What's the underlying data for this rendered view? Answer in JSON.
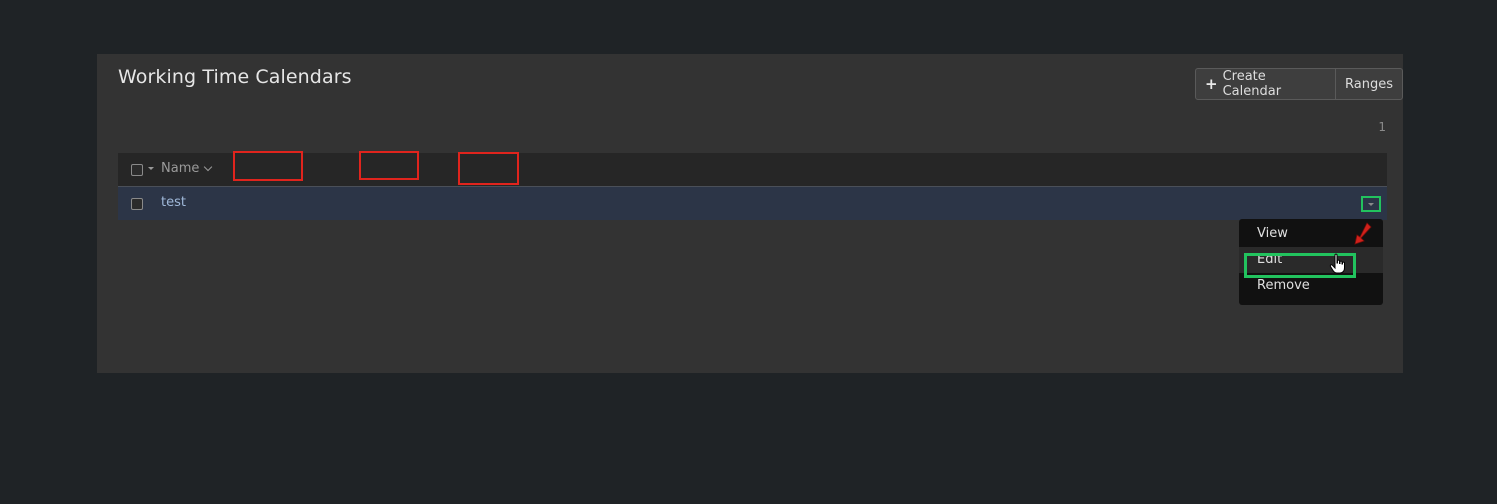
{
  "page": {
    "title": "Working Time Calendars"
  },
  "toolbar": {
    "create_label": "Create Calendar",
    "create_icon": "plus-icon",
    "ranges_label": "Ranges"
  },
  "pagination": {
    "text": "1"
  },
  "table": {
    "columns": [
      {
        "label": "Name"
      }
    ],
    "rows": [
      {
        "name": "test"
      }
    ]
  },
  "row_menu": {
    "items": [
      {
        "label": "View"
      },
      {
        "label": "Edit"
      },
      {
        "label": "Remove"
      }
    ],
    "highlighted": "Edit"
  },
  "annotations": {
    "red_box_color": "#e0241d",
    "green_box_color": "#22c35e"
  }
}
